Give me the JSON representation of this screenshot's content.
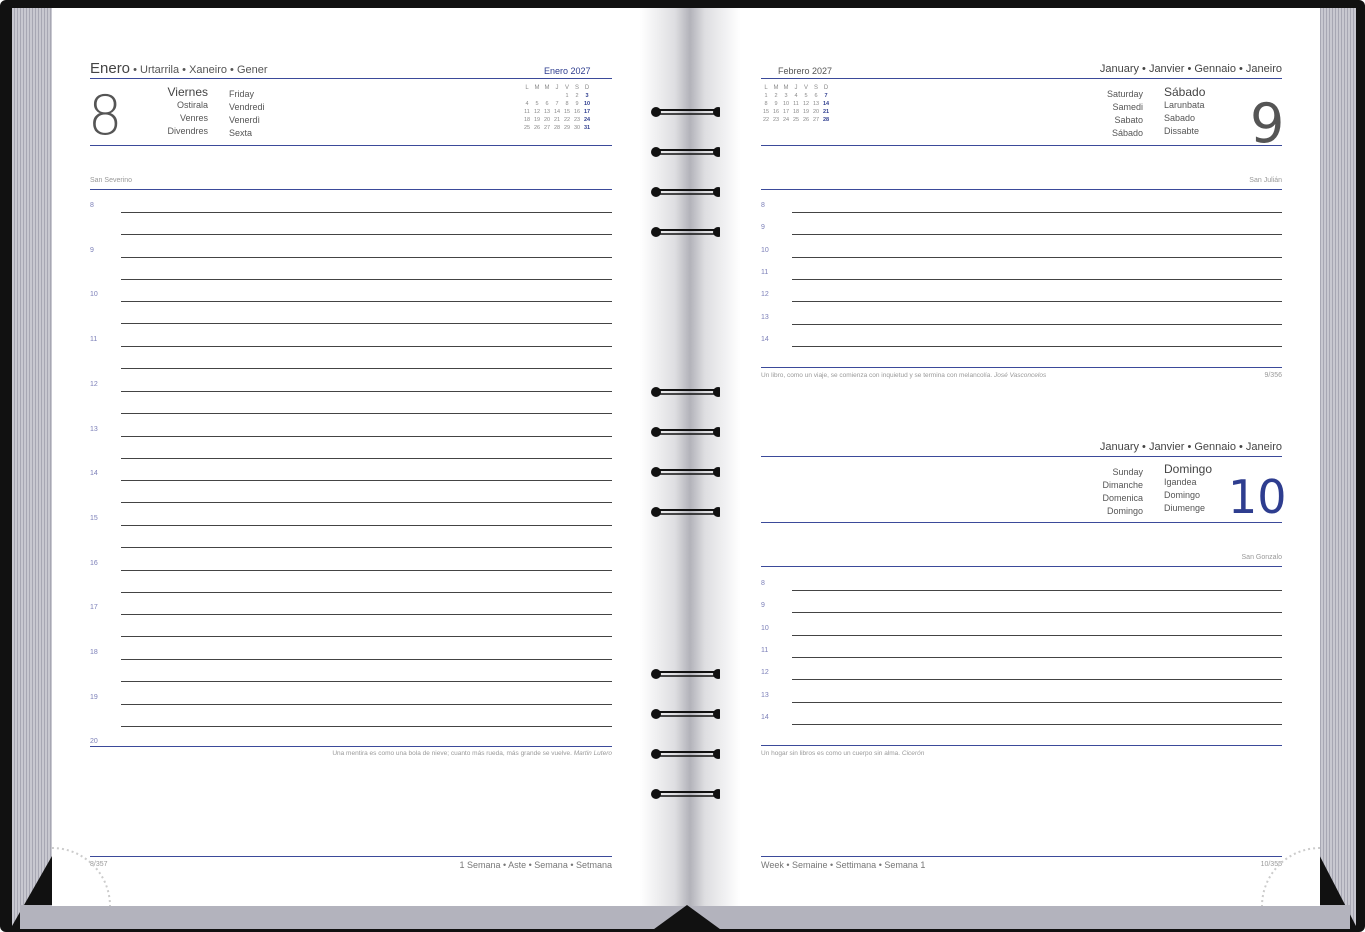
{
  "left_page": {
    "month_header": "Enero",
    "month_translations": " • Urtarrila • Xaneiro • Gener",
    "mini_cal_title": "Enero 2027",
    "mini_cal_headers": [
      "L",
      "M",
      "M",
      "J",
      "V",
      "S",
      "D"
    ],
    "mini_cal_rows": [
      [
        "",
        "",
        "",
        "",
        "1",
        "2",
        "3"
      ],
      [
        "4",
        "5",
        "6",
        "7",
        "8",
        "9",
        "10"
      ],
      [
        "11",
        "12",
        "13",
        "14",
        "15",
        "16",
        "17"
      ],
      [
        "18",
        "19",
        "20",
        "21",
        "22",
        "23",
        "24"
      ],
      [
        "25",
        "26",
        "27",
        "28",
        "29",
        "30",
        "31"
      ]
    ],
    "day_number": "8",
    "day_names_left": [
      "Viernes",
      "Ostirala",
      "Venres",
      "Divendres"
    ],
    "day_names_right": [
      "Friday",
      "Vendredi",
      "Venerdì",
      "Sexta"
    ],
    "saint": "San Severino",
    "hours": [
      "8",
      "9",
      "10",
      "11",
      "12",
      "13",
      "14",
      "15",
      "16",
      "17",
      "18",
      "19",
      "20"
    ],
    "quote": "Una mentira es como una bola de nieve; cuanto más rueda, más grande se vuelve.",
    "quote_author": "Martin Lutero",
    "footer_page": "8/357",
    "footer_week": "1 Semana • Aste • Semana • Setmana"
  },
  "right_page": {
    "mini_cal_title": "Febrero 2027",
    "mini_cal_headers": [
      "L",
      "M",
      "M",
      "J",
      "V",
      "S",
      "D"
    ],
    "mini_cal_rows": [
      [
        "1",
        "2",
        "3",
        "4",
        "5",
        "6",
        "7"
      ],
      [
        "8",
        "9",
        "10",
        "11",
        "12",
        "13",
        "14"
      ],
      [
        "15",
        "16",
        "17",
        "18",
        "19",
        "20",
        "21"
      ],
      [
        "22",
        "23",
        "24",
        "25",
        "26",
        "27",
        "28"
      ]
    ],
    "month_header": "January • Janvier • Gennaio • Janeiro",
    "day1": {
      "number": "9",
      "names_left": [
        "Saturday",
        "Samedi",
        "Sabato",
        "Sábado"
      ],
      "names_right": [
        "Sábado",
        "Larunbata",
        "Sabado",
        "Dissabte"
      ],
      "saint": "San Julián",
      "hours": [
        "8",
        "9",
        "10",
        "11",
        "12",
        "13",
        "14"
      ],
      "quote": "Un libro, como un viaje, se comienza con inquietud y se termina con melancolía.",
      "quote_author": "José Vasconcelos",
      "page_count": "9/356"
    },
    "day2": {
      "month_header": "January • Janvier • Gennaio • Janeiro",
      "number": "10",
      "names_left": [
        "Sunday",
        "Dimanche",
        "Domenica",
        "Domingo"
      ],
      "names_right": [
        "Domingo",
        "Igandea",
        "Domingo",
        "Diumenge"
      ],
      "saint": "San Gonzalo",
      "hours": [
        "8",
        "9",
        "10",
        "11",
        "12",
        "13",
        "14"
      ],
      "quote": "Un hogar sin libros es como un cuerpo sin alma.",
      "quote_author": "Cicerón"
    },
    "footer_week": "Week • Semaine • Settimana • Semana 1",
    "footer_page": "10/355"
  },
  "colors": {
    "accent": "#2e3d8f",
    "cover": "#111111",
    "edge": "#b9b9c2"
  }
}
